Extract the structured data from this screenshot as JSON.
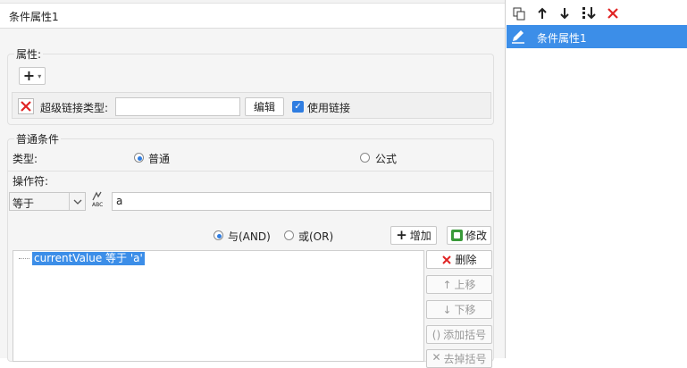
{
  "panel": {
    "title": "条件属性1",
    "attribute_section": {
      "label": "属性:",
      "add_symbol": "+",
      "dropdown_symbol": "▾",
      "hyperlink_type_label": "超级链接类型:",
      "hyperlink_type_value": "",
      "edit_label": "编辑",
      "use_link_label": "使用链接",
      "use_link_checked": true
    },
    "normal_condition": {
      "label": "普通条件",
      "type_label": "类型:",
      "type_normal": "普通",
      "type_formula": "公式",
      "selected_type": "普通",
      "operator_label": "操作符:",
      "operator_value": "等于",
      "abc_icon_text": "ABC",
      "value": "a"
    },
    "logic": {
      "and_label": "与(AND)",
      "or_label": "或(OR)",
      "selected": "与(AND)"
    },
    "buttons": {
      "add": "增加",
      "modify": "修改",
      "delete": "删除",
      "up": "上移",
      "down": "下移",
      "add_bracket": "添加括号",
      "remove_bracket": "去掉括号"
    },
    "condition_list": [
      "currentValue 等于 'a'"
    ]
  },
  "sidebar": {
    "items": [
      {
        "label": "条件属性1",
        "selected": true
      }
    ]
  },
  "colors": {
    "accent": "#3c8ee8",
    "delete_red": "#e02424",
    "modify_green": "#3a9a3a"
  }
}
